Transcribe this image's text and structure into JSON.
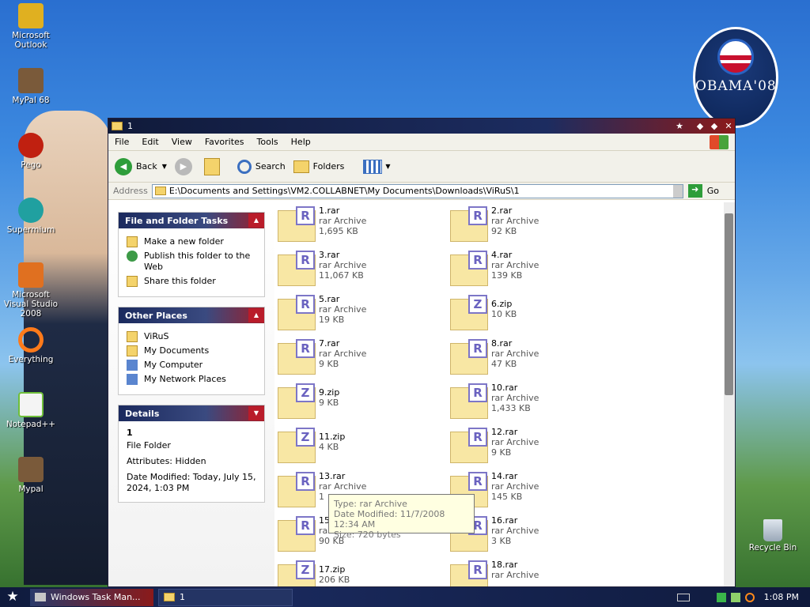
{
  "desktop": {
    "icons": [
      {
        "label": "Microsoft Outlook",
        "icon": "outlook-icon",
        "color": "#e0b020"
      },
      {
        "label": "MyPal 68",
        "icon": "mypal-icon",
        "color": "#7a5a3a"
      },
      {
        "label": "Pego",
        "icon": "pego-icon",
        "color": "#c02010"
      },
      {
        "label": "Supermium",
        "icon": "supermium-icon",
        "color": "#20a0a0"
      },
      {
        "label": "Microsoft Visual Studio 2008",
        "icon": "visual-studio-icon",
        "color": "#e07020"
      },
      {
        "label": "Everything",
        "icon": "everything-icon",
        "color": "#ff7a1a"
      },
      {
        "label": "Notepad++",
        "icon": "notepad-plus-plus-icon",
        "color": "#6fbf3a"
      },
      {
        "label": "Mypal",
        "icon": "mypal-icon",
        "color": "#7a5a3a"
      }
    ],
    "recycle_bin": "Recycle Bin",
    "logo_text": "OBAMA'08"
  },
  "window": {
    "title": "1",
    "menu": [
      "File",
      "Edit",
      "View",
      "Favorites",
      "Tools",
      "Help"
    ],
    "toolbar": {
      "back": "Back",
      "search": "Search",
      "folders": "Folders"
    },
    "address": {
      "label": "Address",
      "value": "E:\\Documents and Settings\\VM2.COLLABNET\\My Documents\\Downloads\\ViRuS\\1",
      "go": "Go"
    }
  },
  "tasks": {
    "file_folder": {
      "title": "File and Folder Tasks",
      "items": [
        "Make a new folder",
        "Publish this folder to the Web",
        "Share this folder"
      ]
    },
    "other_places": {
      "title": "Other Places",
      "items": [
        "ViRuS",
        "My Documents",
        "My Computer",
        "My Network Places"
      ]
    },
    "details": {
      "title": "Details",
      "name": "1",
      "type": "File Folder",
      "attributes": "Attributes: Hidden",
      "modified": "Date Modified: Today, July 15, 2024, 1:03 PM"
    }
  },
  "files": [
    {
      "name": "1.rar",
      "type": "rar Archive",
      "size": "1,695 KB",
      "badge": "R"
    },
    {
      "name": "2.rar",
      "type": "rar Archive",
      "size": "92 KB",
      "badge": "R"
    },
    {
      "name": "3.rar",
      "type": "rar Archive",
      "size": "11,067 KB",
      "badge": "R"
    },
    {
      "name": "4.rar",
      "type": "rar Archive",
      "size": "139 KB",
      "badge": "R"
    },
    {
      "name": "5.rar",
      "type": "rar Archive",
      "size": "19 KB",
      "badge": "R"
    },
    {
      "name": "6.zip",
      "type": "",
      "size": "10 KB",
      "badge": "Z"
    },
    {
      "name": "7.rar",
      "type": "rar Archive",
      "size": "9 KB",
      "badge": "R"
    },
    {
      "name": "8.rar",
      "type": "rar Archive",
      "size": "47 KB",
      "badge": "R"
    },
    {
      "name": "9.zip",
      "type": "",
      "size": "9 KB",
      "badge": "Z"
    },
    {
      "name": "10.rar",
      "type": "rar Archive",
      "size": "1,433 KB",
      "badge": "R"
    },
    {
      "name": "11.zip",
      "type": "",
      "size": "4 KB",
      "badge": "Z"
    },
    {
      "name": "12.rar",
      "type": "rar Archive",
      "size": "9 KB",
      "badge": "R"
    },
    {
      "name": "13.rar",
      "type": "rar Archive",
      "size": "1",
      "badge": "R"
    },
    {
      "name": "14.rar",
      "type": "rar Archive",
      "size": "145 KB",
      "badge": "R"
    },
    {
      "name": "15.rar",
      "type": "rar Archive",
      "size": "90 KB",
      "badge": "R"
    },
    {
      "name": "16.rar",
      "type": "rar Archive",
      "size": "3 KB",
      "badge": "R"
    },
    {
      "name": "17.zip",
      "type": "",
      "size": "206 KB",
      "badge": "Z"
    },
    {
      "name": "18.rar",
      "type": "rar Archive",
      "size": "",
      "badge": "R"
    }
  ],
  "tooltip": {
    "type": "Type: rar Archive",
    "modified": "Date Modified: 11/7/2008 12:34 AM",
    "size": "Size: 720 bytes"
  },
  "taskbar": {
    "tasks": [
      "Windows Task Man...",
      "1"
    ],
    "clock": "1:08 PM"
  }
}
